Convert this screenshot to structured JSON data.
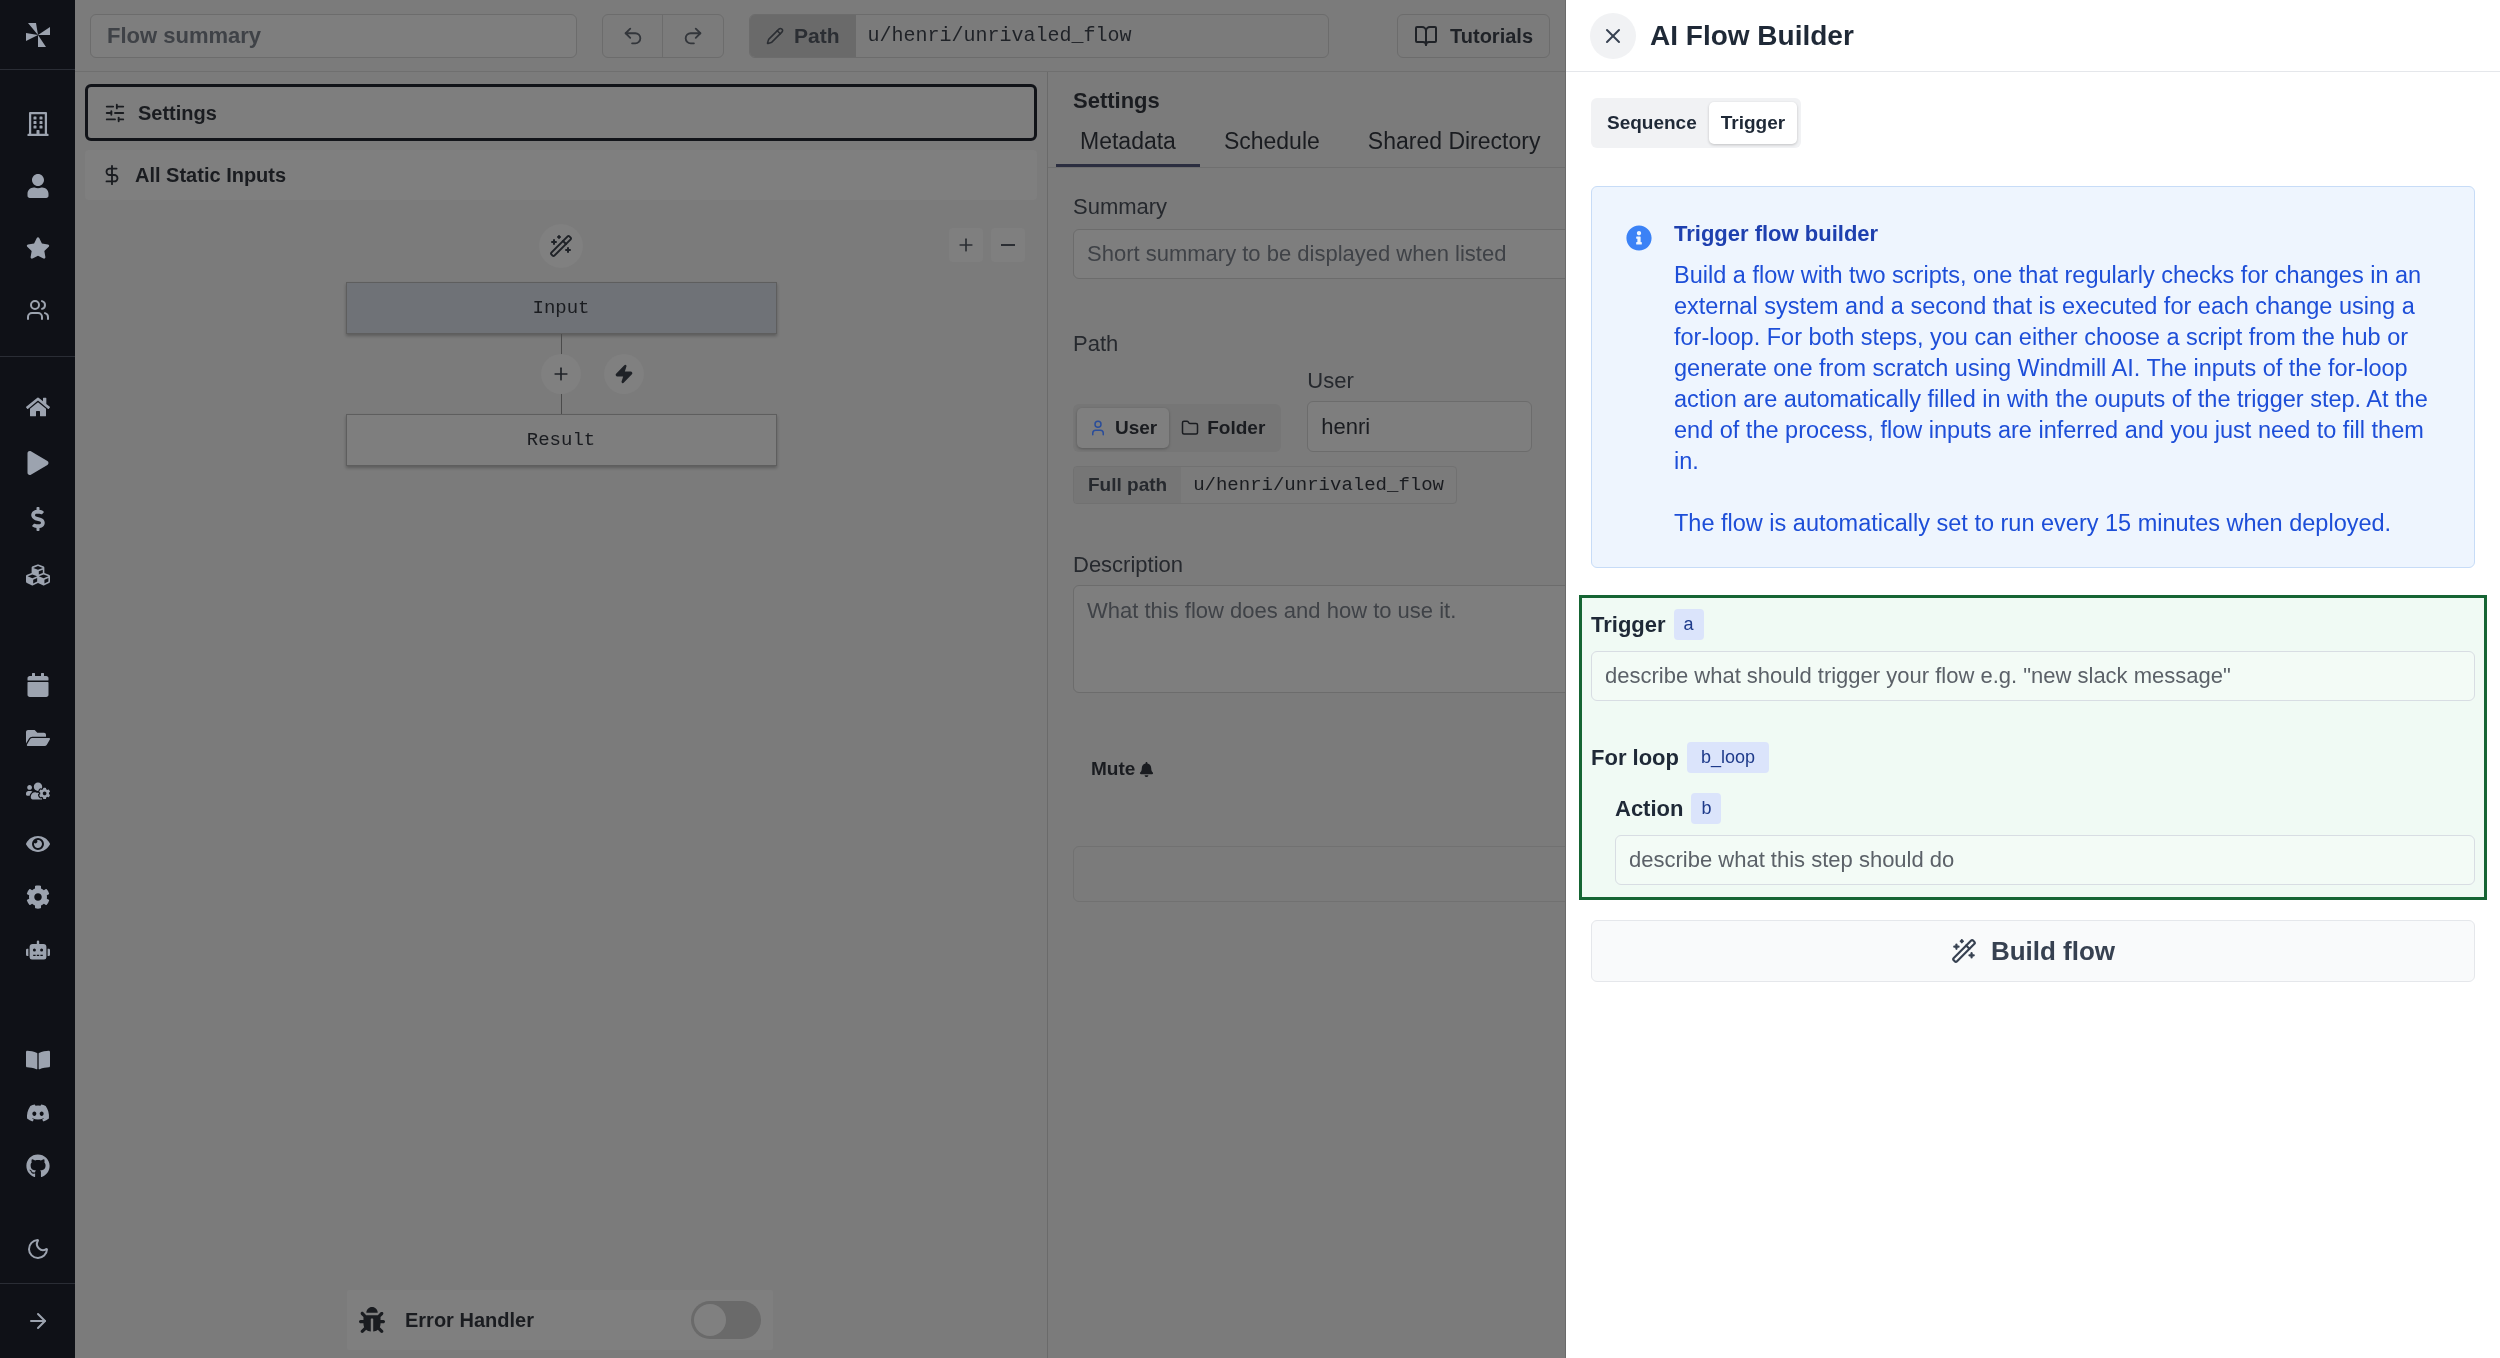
{
  "top_bar": {
    "summary_placeholder": "Flow summary",
    "path_button": "Path",
    "path_value": "u/henri/unrivaled_flow",
    "tutorials": "Tutorials"
  },
  "flow_panel": {
    "items": [
      {
        "kind": "settings",
        "label": "Settings",
        "selected": true
      },
      {
        "kind": "inputs",
        "label": "All Static Inputs",
        "selected": false
      }
    ],
    "nodes": [
      {
        "label": "Input",
        "selected": true
      },
      {
        "label": "Result",
        "selected": false
      }
    ],
    "error_handler": {
      "label": "Error Handler",
      "on": false
    }
  },
  "settings": {
    "title": "Settings",
    "tabs": [
      {
        "label": "Metadata",
        "selected": true
      },
      {
        "label": "Schedule",
        "selected": false
      },
      {
        "label": "Shared Directory",
        "selected": false
      }
    ],
    "summary": {
      "label": "Summary",
      "placeholder": "Short summary to be displayed when listed"
    },
    "path": {
      "label": "Path",
      "options": [
        {
          "kind": "user",
          "label": "User",
          "selected": true
        },
        {
          "kind": "folder",
          "label": "Folder",
          "selected": false
        }
      ],
      "user_label": "User",
      "user_value": "henri",
      "full_path_label": "Full path",
      "full_path": "u/henri/unrivaled_flow"
    },
    "description": {
      "label": "Description",
      "placeholder": "What this flow does and how to use it."
    },
    "mute_label": "Mute"
  },
  "ai_builder": {
    "title": "AI Flow Builder",
    "tabs": [
      {
        "label": "Sequence",
        "selected": false
      },
      {
        "label": "Trigger",
        "selected": true
      }
    ],
    "info": {
      "title": "Trigger flow builder",
      "paragraphs": [
        "Build a flow with two scripts, one that regularly checks for changes in an external system and a second that is executed for each change using a for-loop. For both steps, you can either choose a script from the hub or generate one from scratch using Windmill AI. The inputs of the for-loop action are automatically filled in with the ouputs of the trigger step. At the end of the process, flow inputs are inferred and you just need to fill them in.",
        "The flow is automatically set to run every 15 minutes when deployed."
      ]
    },
    "steps": [
      {
        "kind": "step",
        "label": "Trigger",
        "badge": "a",
        "placeholder": "describe what should trigger your flow e.g. \"new slack message\""
      },
      {
        "kind": "loop",
        "label": "For loop",
        "badge": "b_loop",
        "children": [
          {
            "kind": "step",
            "label": "Action",
            "badge": "b",
            "placeholder": "describe what this step should do"
          }
        ]
      }
    ],
    "build_button": "Build flow"
  }
}
